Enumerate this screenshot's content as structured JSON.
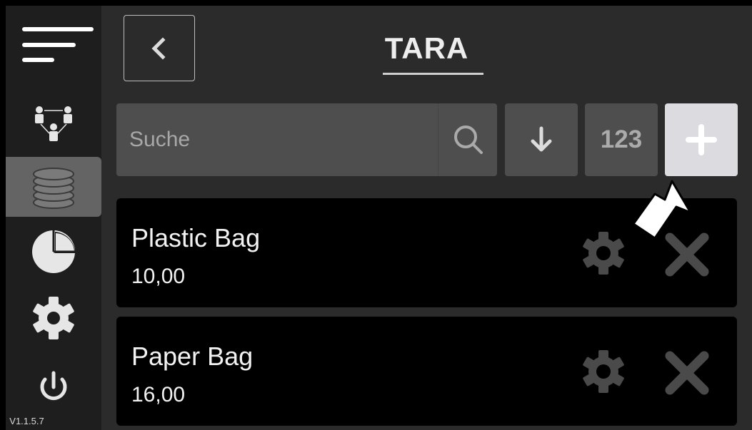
{
  "header": {
    "title": "TARA"
  },
  "search": {
    "placeholder": "Suche",
    "value": ""
  },
  "toolbar": {
    "numeric_label": "123"
  },
  "items": [
    {
      "name": "Plastic Bag",
      "value": "10,00"
    },
    {
      "name": "Paper Bag",
      "value": "16,00"
    }
  ],
  "sidebar": {
    "version": "V1.1.5.7",
    "items": [
      {
        "icon": "menu-icon"
      },
      {
        "icon": "users-network-icon"
      },
      {
        "icon": "stack-database-icon",
        "active": true
      },
      {
        "icon": "pie-chart-icon"
      },
      {
        "icon": "gear-icon"
      },
      {
        "icon": "power-icon"
      }
    ]
  },
  "colors": {
    "background": "#2b2b2b",
    "sidebar": "#1e1e1e",
    "active": "#646464",
    "button": "#4e4e4e",
    "add_button": "#dcdce0",
    "card": "#000000"
  }
}
